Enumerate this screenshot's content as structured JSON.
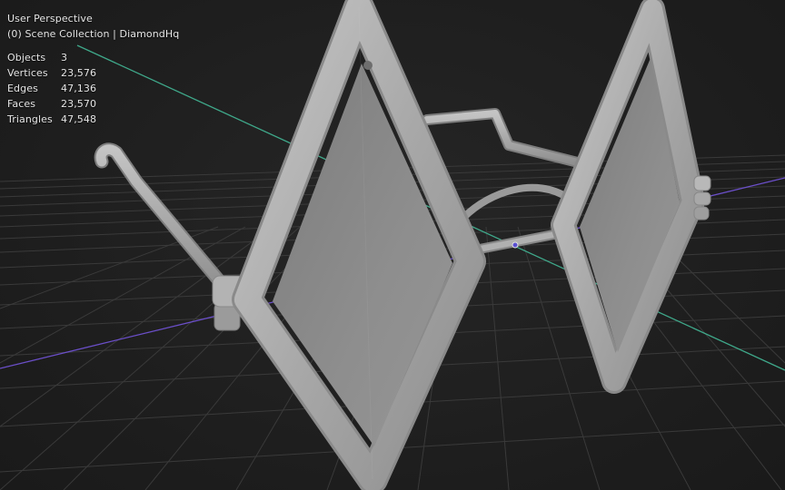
{
  "viewport": {
    "perspective": "User Perspective",
    "collection": "(0) Scene Collection | DiamondHq",
    "stats": [
      {
        "label": "Objects",
        "value": "3"
      },
      {
        "label": "Vertices",
        "value": "23,576"
      },
      {
        "label": "Edges",
        "value": "47,136"
      },
      {
        "label": "Faces",
        "value": "23,570"
      },
      {
        "label": "Triangles",
        "value": "47,548"
      }
    ]
  },
  "colors": {
    "background": "#1f1f1f",
    "grid": "#3a3a3a",
    "x_axis": "#6b4fc9",
    "y_axis": "#3fa88a",
    "model": "#a9a9a9",
    "lens": "#8d8d8d",
    "overlay_text": "#e6e6e6"
  }
}
